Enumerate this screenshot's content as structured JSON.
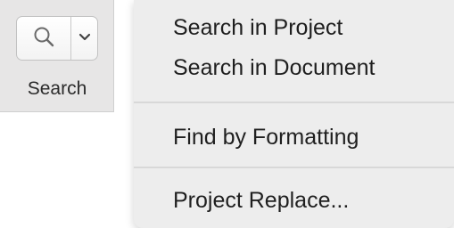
{
  "toolbar": {
    "search_label": "Search",
    "icons": {
      "main": "magnifier-icon",
      "dropdown": "chevron-down-icon"
    }
  },
  "menu": {
    "items": [
      {
        "label": "Search in Project"
      },
      {
        "label": "Search in Document"
      },
      {
        "label": "Find by Formatting"
      },
      {
        "label": "Project Replace..."
      }
    ]
  }
}
